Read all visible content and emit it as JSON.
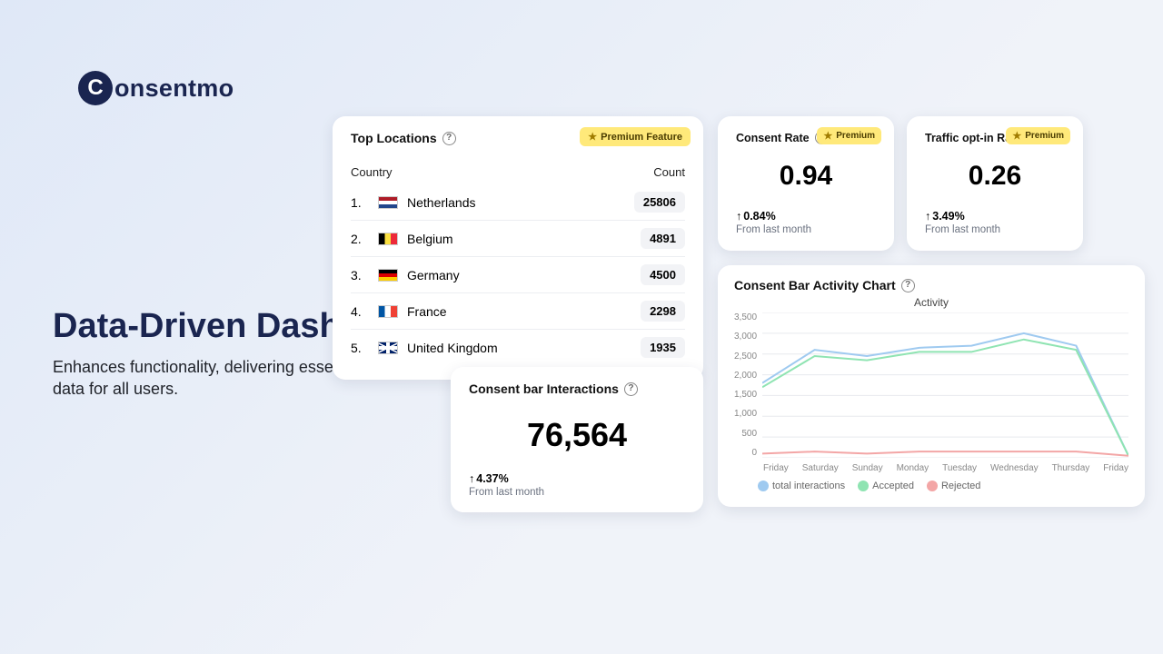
{
  "logo": {
    "text": "onsentmo",
    "mark_letter": "C"
  },
  "hero": {
    "title": "Data-Driven Dashboard",
    "subtitle": "Enhances functionality, delivering essential consent data for all users."
  },
  "premium_label": "Premium",
  "premium_feature_label": "Premium Feature",
  "help_glyph": "?",
  "top_locations": {
    "title": "Top Locations",
    "col_country": "Country",
    "col_count": "Count",
    "rows": [
      {
        "idx": "1.",
        "name": "Netherlands",
        "count": "25806",
        "flag": "flag-nl"
      },
      {
        "idx": "2.",
        "name": "Belgium",
        "count": "4891",
        "flag": "flag-be"
      },
      {
        "idx": "3.",
        "name": "Germany",
        "count": "4500",
        "flag": "flag-de"
      },
      {
        "idx": "4.",
        "name": "France",
        "count": "2298",
        "flag": "flag-fr"
      },
      {
        "idx": "5.",
        "name": "United Kingdom",
        "count": "1935",
        "flag": "flag-uk"
      }
    ]
  },
  "consent_rate": {
    "title": "Consent Rate",
    "value": "0.94",
    "delta": "0.84%",
    "sub": "From last month"
  },
  "traffic_optin": {
    "title": "Traffic opt-in Rate",
    "value": "0.26",
    "delta": "3.49%",
    "sub": "From last month"
  },
  "interactions": {
    "title": "Consent bar Interactions",
    "value": "76,564",
    "delta": "4.37%",
    "sub": "From last month"
  },
  "activity": {
    "title": "Consent Bar Activity Chart",
    "subtitle": "Activity",
    "legend": {
      "total": "total interactions",
      "accepted": "Accepted",
      "rejected": "Rejected"
    },
    "colors": {
      "total": "#9fcaf0",
      "accepted": "#8fe4b2",
      "rejected": "#f3a6a6"
    }
  },
  "chart_data": {
    "type": "line",
    "categories": [
      "Friday",
      "Saturday",
      "Sunday",
      "Monday",
      "Tuesday",
      "Wednesday",
      "Thursday",
      "Friday"
    ],
    "series": [
      {
        "name": "total interactions",
        "values": [
          1800,
          2600,
          2450,
          2650,
          2700,
          3000,
          2700,
          50
        ]
      },
      {
        "name": "Accepted",
        "values": [
          1700,
          2450,
          2350,
          2550,
          2550,
          2850,
          2600,
          50
        ]
      },
      {
        "name": "Rejected",
        "values": [
          100,
          150,
          100,
          150,
          150,
          150,
          150,
          50
        ]
      }
    ],
    "ylim": [
      0,
      3500
    ],
    "ylabel": "",
    "xlabel": "",
    "y_ticks": [
      "3,500",
      "3,000",
      "2,500",
      "2,000",
      "1,500",
      "1,000",
      "500",
      "0"
    ]
  }
}
